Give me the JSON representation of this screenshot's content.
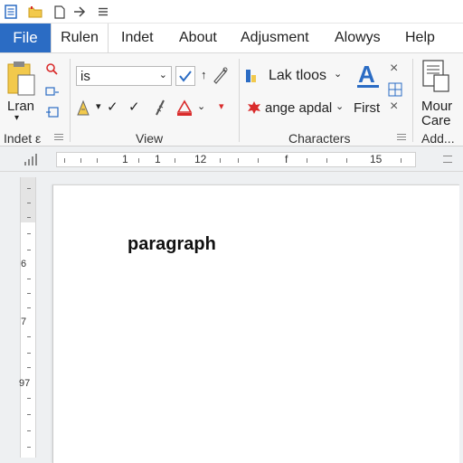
{
  "quick_access": {
    "icons": [
      "document-icon",
      "folder-icon",
      "new-page-icon",
      "arrow-right-icon",
      "menu-icon"
    ]
  },
  "tabs": [
    {
      "label": "File"
    },
    {
      "label": "Rulen"
    },
    {
      "label": "Indet"
    },
    {
      "label": "About"
    },
    {
      "label": "Adjusment"
    },
    {
      "label": "Alowys"
    },
    {
      "label": "Help"
    }
  ],
  "ribbon": {
    "indet_group": {
      "big_label": "Lran",
      "label": "Indet ε"
    },
    "view_group": {
      "font_value": "is",
      "arrow_label": "↑",
      "label": "View"
    },
    "characters_group": {
      "style_label": "Lak tloos",
      "change_label": "ange apdal",
      "first_label": "First",
      "label": "Characters"
    },
    "add_group": {
      "line1": "Mour",
      "line2": "Care",
      "label": "Add..."
    }
  },
  "ruler": {
    "labels": [
      "1",
      "1",
      "12",
      "f",
      "15"
    ]
  },
  "vertical_ruler": {
    "labels": [
      "6",
      "7",
      "97"
    ]
  },
  "document": {
    "text": "paragraph"
  },
  "colors": {
    "file_tab": "#2b6cc4",
    "accent_blue": "#2b6cc4",
    "red": "#d92b2b",
    "yellow": "#f2c94c"
  }
}
